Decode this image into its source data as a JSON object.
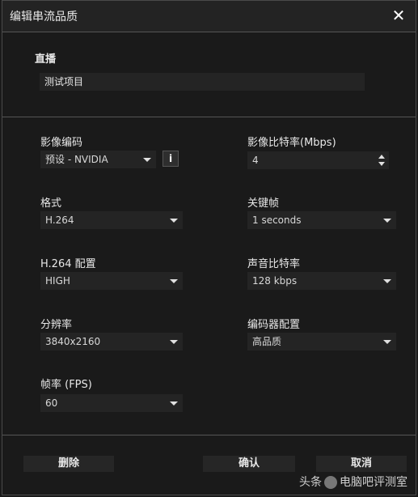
{
  "dialog": {
    "title": "编辑串流品质",
    "close_label": "✕"
  },
  "stream": {
    "label": "直播",
    "value": "测试项目"
  },
  "left": {
    "encoder": {
      "label": "影像编码",
      "value": "预设 - NVIDIA",
      "info": "i"
    },
    "format": {
      "label": "格式",
      "value": "H.264"
    },
    "profile": {
      "label": "H.264 配置",
      "value": "HIGH"
    },
    "resolution": {
      "label": "分辨率",
      "value": "3840x2160"
    },
    "fps": {
      "label": "帧率 (FPS)",
      "value": "60"
    }
  },
  "right": {
    "bitrate": {
      "label": "影像比特率(Mbps)",
      "value": "4"
    },
    "keyframe": {
      "label": "关键帧",
      "value": "1 seconds"
    },
    "audio_bitrate": {
      "label": "声音比特率",
      "value": "128 kbps"
    },
    "encoder_preset": {
      "label": "编码器配置",
      "value": "高品质"
    }
  },
  "footer": {
    "delete_label": "删除",
    "confirm_label": "确认",
    "cancel_label": "取消"
  },
  "watermark": {
    "text_left": "头条",
    "text_right": "电脑吧评测室"
  }
}
